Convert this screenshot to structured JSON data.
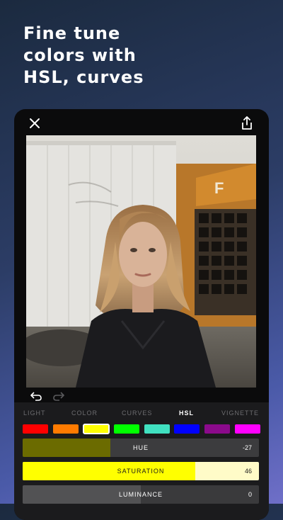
{
  "headline": {
    "lines": [
      "Fine tune",
      "colors with",
      "HSL, curves"
    ]
  },
  "toolbar": {
    "close_icon": "close-icon",
    "share_icon": "share-icon",
    "undo_icon": "undo-icon",
    "redo_icon": "redo-icon"
  },
  "tabs": [
    {
      "label": "LIGHT",
      "active": false
    },
    {
      "label": "COLOR",
      "active": false
    },
    {
      "label": "CURVES",
      "active": false
    },
    {
      "label": "HSL",
      "active": true
    },
    {
      "label": "VIGNETTE",
      "active": false
    }
  ],
  "swatches": [
    {
      "name": "red",
      "color": "#ff0000"
    },
    {
      "name": "orange",
      "color": "#ff7b00"
    },
    {
      "name": "yellow",
      "color": "#ffff00",
      "selected": true
    },
    {
      "name": "green",
      "color": "#00ff00"
    },
    {
      "name": "aqua",
      "color": "#40e0c0"
    },
    {
      "name": "blue",
      "color": "#0000ff"
    },
    {
      "name": "purple",
      "color": "#8b0a8b"
    },
    {
      "name": "magenta",
      "color": "#ff00ff"
    }
  ],
  "sliders": {
    "hue": {
      "label": "HUE",
      "value": "-27",
      "fill_fraction": 0.37,
      "fill_color": "#6b6b00",
      "track_color": "#3c3c3e"
    },
    "saturation": {
      "label": "SATURATION",
      "value": "46",
      "fill_fraction": 0.73,
      "fill_color": "#ffff00",
      "track_color": "#fffbc8"
    },
    "luminance": {
      "label": "LUMINANCE",
      "value": "0",
      "fill_fraction": 0.5,
      "fill_color": "#525254",
      "track_color": "#3a3a3c"
    }
  },
  "colors": {
    "panel_bg": "#1b1b1d",
    "phone_bg": "#0b0b0c",
    "active_tab": "#ffffff",
    "inactive_tab": "#6d6d70"
  }
}
